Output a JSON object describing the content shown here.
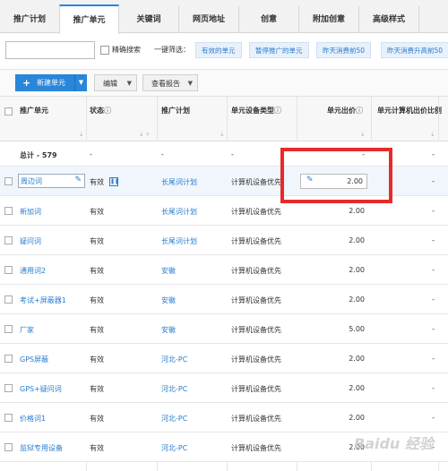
{
  "tabs": [
    {
      "label": "推广计划",
      "active": false
    },
    {
      "label": "推广单元",
      "active": true
    },
    {
      "label": "关键词",
      "active": false
    },
    {
      "label": "网页地址",
      "active": false
    },
    {
      "label": "创意",
      "active": false
    },
    {
      "label": "附加创意",
      "active": false
    },
    {
      "label": "高级样式",
      "active": false
    }
  ],
  "filter": {
    "search_value": "",
    "exact_label": "精确搜索",
    "quick_label": "一键筛选：",
    "quick_filters": [
      "有效的单元",
      "暂停推广的单元",
      "昨天消费前50",
      "昨天消费升高前50"
    ]
  },
  "toolbar": {
    "new_label": "新建单元",
    "edit_label": "编辑",
    "report_label": "查看报告"
  },
  "columns": [
    "推广单元",
    "状态",
    "推广计划",
    "单元设备类型",
    "单元出价",
    "单元计算机出价比例"
  ],
  "total": {
    "label": "总计 - 579",
    "status": "-",
    "plan": "-",
    "device": "-",
    "bid": "-",
    "ratio": "-"
  },
  "rows": [
    {
      "unit": "周边词",
      "status": "有效",
      "plan": "长尾词计划",
      "device": "计算机设备优先",
      "bid": "2.00",
      "ratio": "-",
      "editing": true
    },
    {
      "unit": "新加词",
      "status": "有效",
      "plan": "长尾词计划",
      "device": "计算机设备优先",
      "bid": "2.00",
      "ratio": "-"
    },
    {
      "unit": "疑问词",
      "status": "有效",
      "plan": "长尾词计划",
      "device": "计算机设备优先",
      "bid": "2.00",
      "ratio": "-"
    },
    {
      "unit": "通用词2",
      "status": "有效",
      "plan": "安徽",
      "device": "计算机设备优先",
      "bid": "2.00",
      "ratio": "-"
    },
    {
      "unit": "考试+屏蔽器1",
      "status": "有效",
      "plan": "安徽",
      "device": "计算机设备优先",
      "bid": "2.00",
      "ratio": "-"
    },
    {
      "unit": "厂家",
      "status": "有效",
      "plan": "安徽",
      "device": "计算机设备优先",
      "bid": "5.00",
      "ratio": "-"
    },
    {
      "unit": "GPS屏蔽",
      "status": "有效",
      "plan": "河北-PC",
      "device": "计算机设备优先",
      "bid": "2.00",
      "ratio": "-"
    },
    {
      "unit": "GPS+疑问词",
      "status": "有效",
      "plan": "河北-PC",
      "device": "计算机设备优先",
      "bid": "2.00",
      "ratio": "-"
    },
    {
      "unit": "价格词1",
      "status": "有效",
      "plan": "河北-PC",
      "device": "计算机设备优先",
      "bid": "2.00",
      "ratio": "-"
    },
    {
      "unit": "监狱专用设备",
      "status": "有效",
      "plan": "河北-PC",
      "device": "计算机设备优先",
      "bid": "2.00",
      "ratio": "-"
    }
  ],
  "watermark": "Baidu 经验",
  "colors": {
    "accent": "#2a86d8",
    "link": "#2a7ccc",
    "highlight": "#e52b2b"
  }
}
